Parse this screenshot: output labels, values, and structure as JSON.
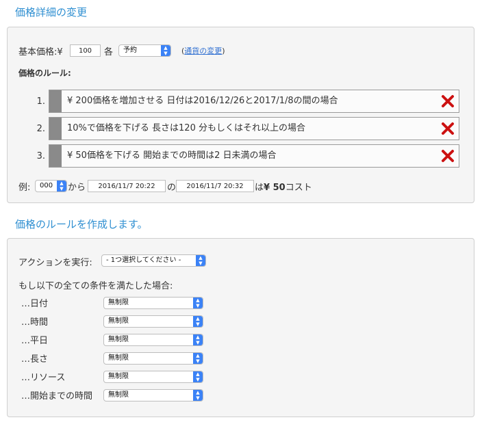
{
  "pricing_details": {
    "title": "価格詳細の変更",
    "base_price_label": "基本価格:¥",
    "base_price_value": "100",
    "each_label": "各",
    "unit_select": "予約",
    "currency_open": "(",
    "currency_link": "通貨の変更",
    "currency_close": ")",
    "rules_heading": "価格のルール:",
    "rules": [
      {
        "num": "1.",
        "text": "¥ 200価格を増加させる 日付は2016/12/26と2017/1/8の間の場合"
      },
      {
        "num": "2.",
        "text": "10%で価格を下げる 長さは120 分もしくはそれ以上の場合"
      },
      {
        "num": "3.",
        "text": "¥ 50価格を下げる 開始までの時間は2 日未満の場合"
      }
    ],
    "example": {
      "label": "例:",
      "select": "000",
      "from_label": "から",
      "start": "2016/11/7 20:22",
      "of_label": "の",
      "end": "2016/11/7 20:32",
      "wa_label": "は",
      "amount": "¥ 50",
      "cost_label": "コスト"
    }
  },
  "create_rule": {
    "title": "価格のルールを作成します。",
    "action_label": "アクションを実行:",
    "action_select": "- 1つ選択してください -",
    "condition_heading": "もし以下の全ての条件を満たした場合:",
    "conditions": [
      {
        "label": "…日付",
        "value": "無制限"
      },
      {
        "label": "…時間",
        "value": "無制限"
      },
      {
        "label": "…平日",
        "value": "無制限"
      },
      {
        "label": "…長さ",
        "value": "無制限"
      },
      {
        "label": "…リソース",
        "value": "無制限"
      },
      {
        "label": "…開始までの時間",
        "value": "無制限"
      }
    ]
  },
  "colors": {
    "title_blue": "#2f8fd1",
    "delete_red": "#cc1111",
    "select_blue": "#3b82f6"
  }
}
